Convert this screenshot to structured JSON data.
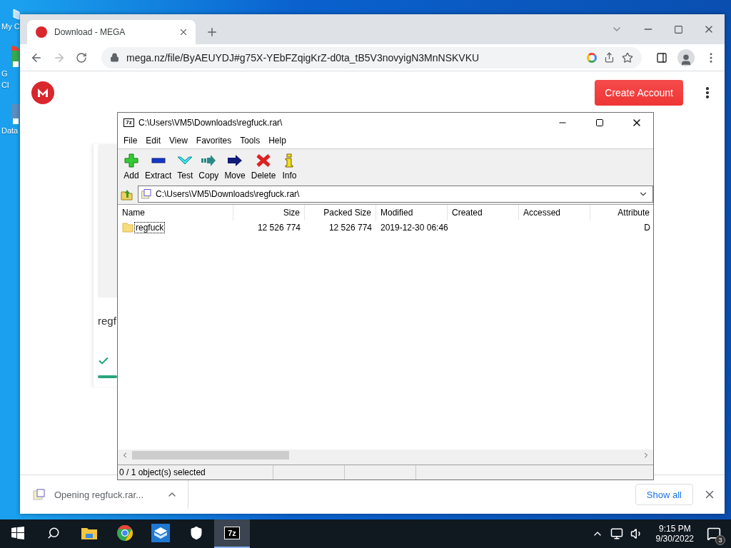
{
  "desktop": {
    "icons": [
      {
        "kind": "computer",
        "lines": [
          "My C"
        ]
      },
      {
        "kind": "browser",
        "lines": [
          "G",
          "Cl"
        ]
      },
      {
        "kind": "drive",
        "lines": [
          "Data"
        ]
      }
    ]
  },
  "browser": {
    "tabs": [
      {
        "title": "Download - MEGA",
        "selected": true
      }
    ],
    "url": "mega.nz/file/ByAEUYDJ#g75X-YEbFZqigKrZ-d0ta_tB5V3novyigN3MnNSKVKU",
    "page": {
      "create_account": "Create Account",
      "file_card": {
        "name": "regf",
        "progress": {
          "level": 1
        }
      }
    },
    "download_bar": {
      "item": "Opening regfuck.rar...",
      "show_all": "Show all"
    }
  },
  "archiver": {
    "logo": "7z",
    "title": "C:\\Users\\VM5\\Downloads\\regfuck.rar\\",
    "menu": [
      "File",
      "Edit",
      "View",
      "Favorites",
      "Tools",
      "Help"
    ],
    "toolbar": [
      {
        "kind": "add",
        "label": "Add"
      },
      {
        "kind": "extract",
        "label": "Extract"
      },
      {
        "kind": "test",
        "label": "Test"
      },
      {
        "kind": "copy",
        "label": "Copy"
      },
      {
        "kind": "move",
        "label": "Move"
      },
      {
        "kind": "delete",
        "label": "Delete"
      },
      {
        "kind": "info",
        "label": "Info"
      }
    ],
    "path": "C:\\Users\\VM5\\Downloads\\regfuck.rar\\",
    "columns": [
      "Name",
      "Size",
      "Packed Size",
      "Modified",
      "Created",
      "Accessed",
      "Attribute"
    ],
    "rows": [
      {
        "name": "regfuck",
        "size": "12 526 774",
        "packed_size": "12 526 774",
        "modified": "2019-12-30 06:46",
        "attributes": "D",
        "focused": true
      }
    ],
    "status": "0 / 1 object(s) selected"
  },
  "taskbar": {
    "apps": [
      {
        "kind": "explorer",
        "active": false
      },
      {
        "kind": "browser",
        "active": false
      },
      {
        "kind": "sandbox",
        "active": false
      },
      {
        "kind": "security",
        "active": false
      },
      {
        "kind": "archiver",
        "active": true,
        "label": "7z"
      }
    ],
    "time": "9:15 PM",
    "date": "9/30/2022",
    "notifications": "3"
  }
}
